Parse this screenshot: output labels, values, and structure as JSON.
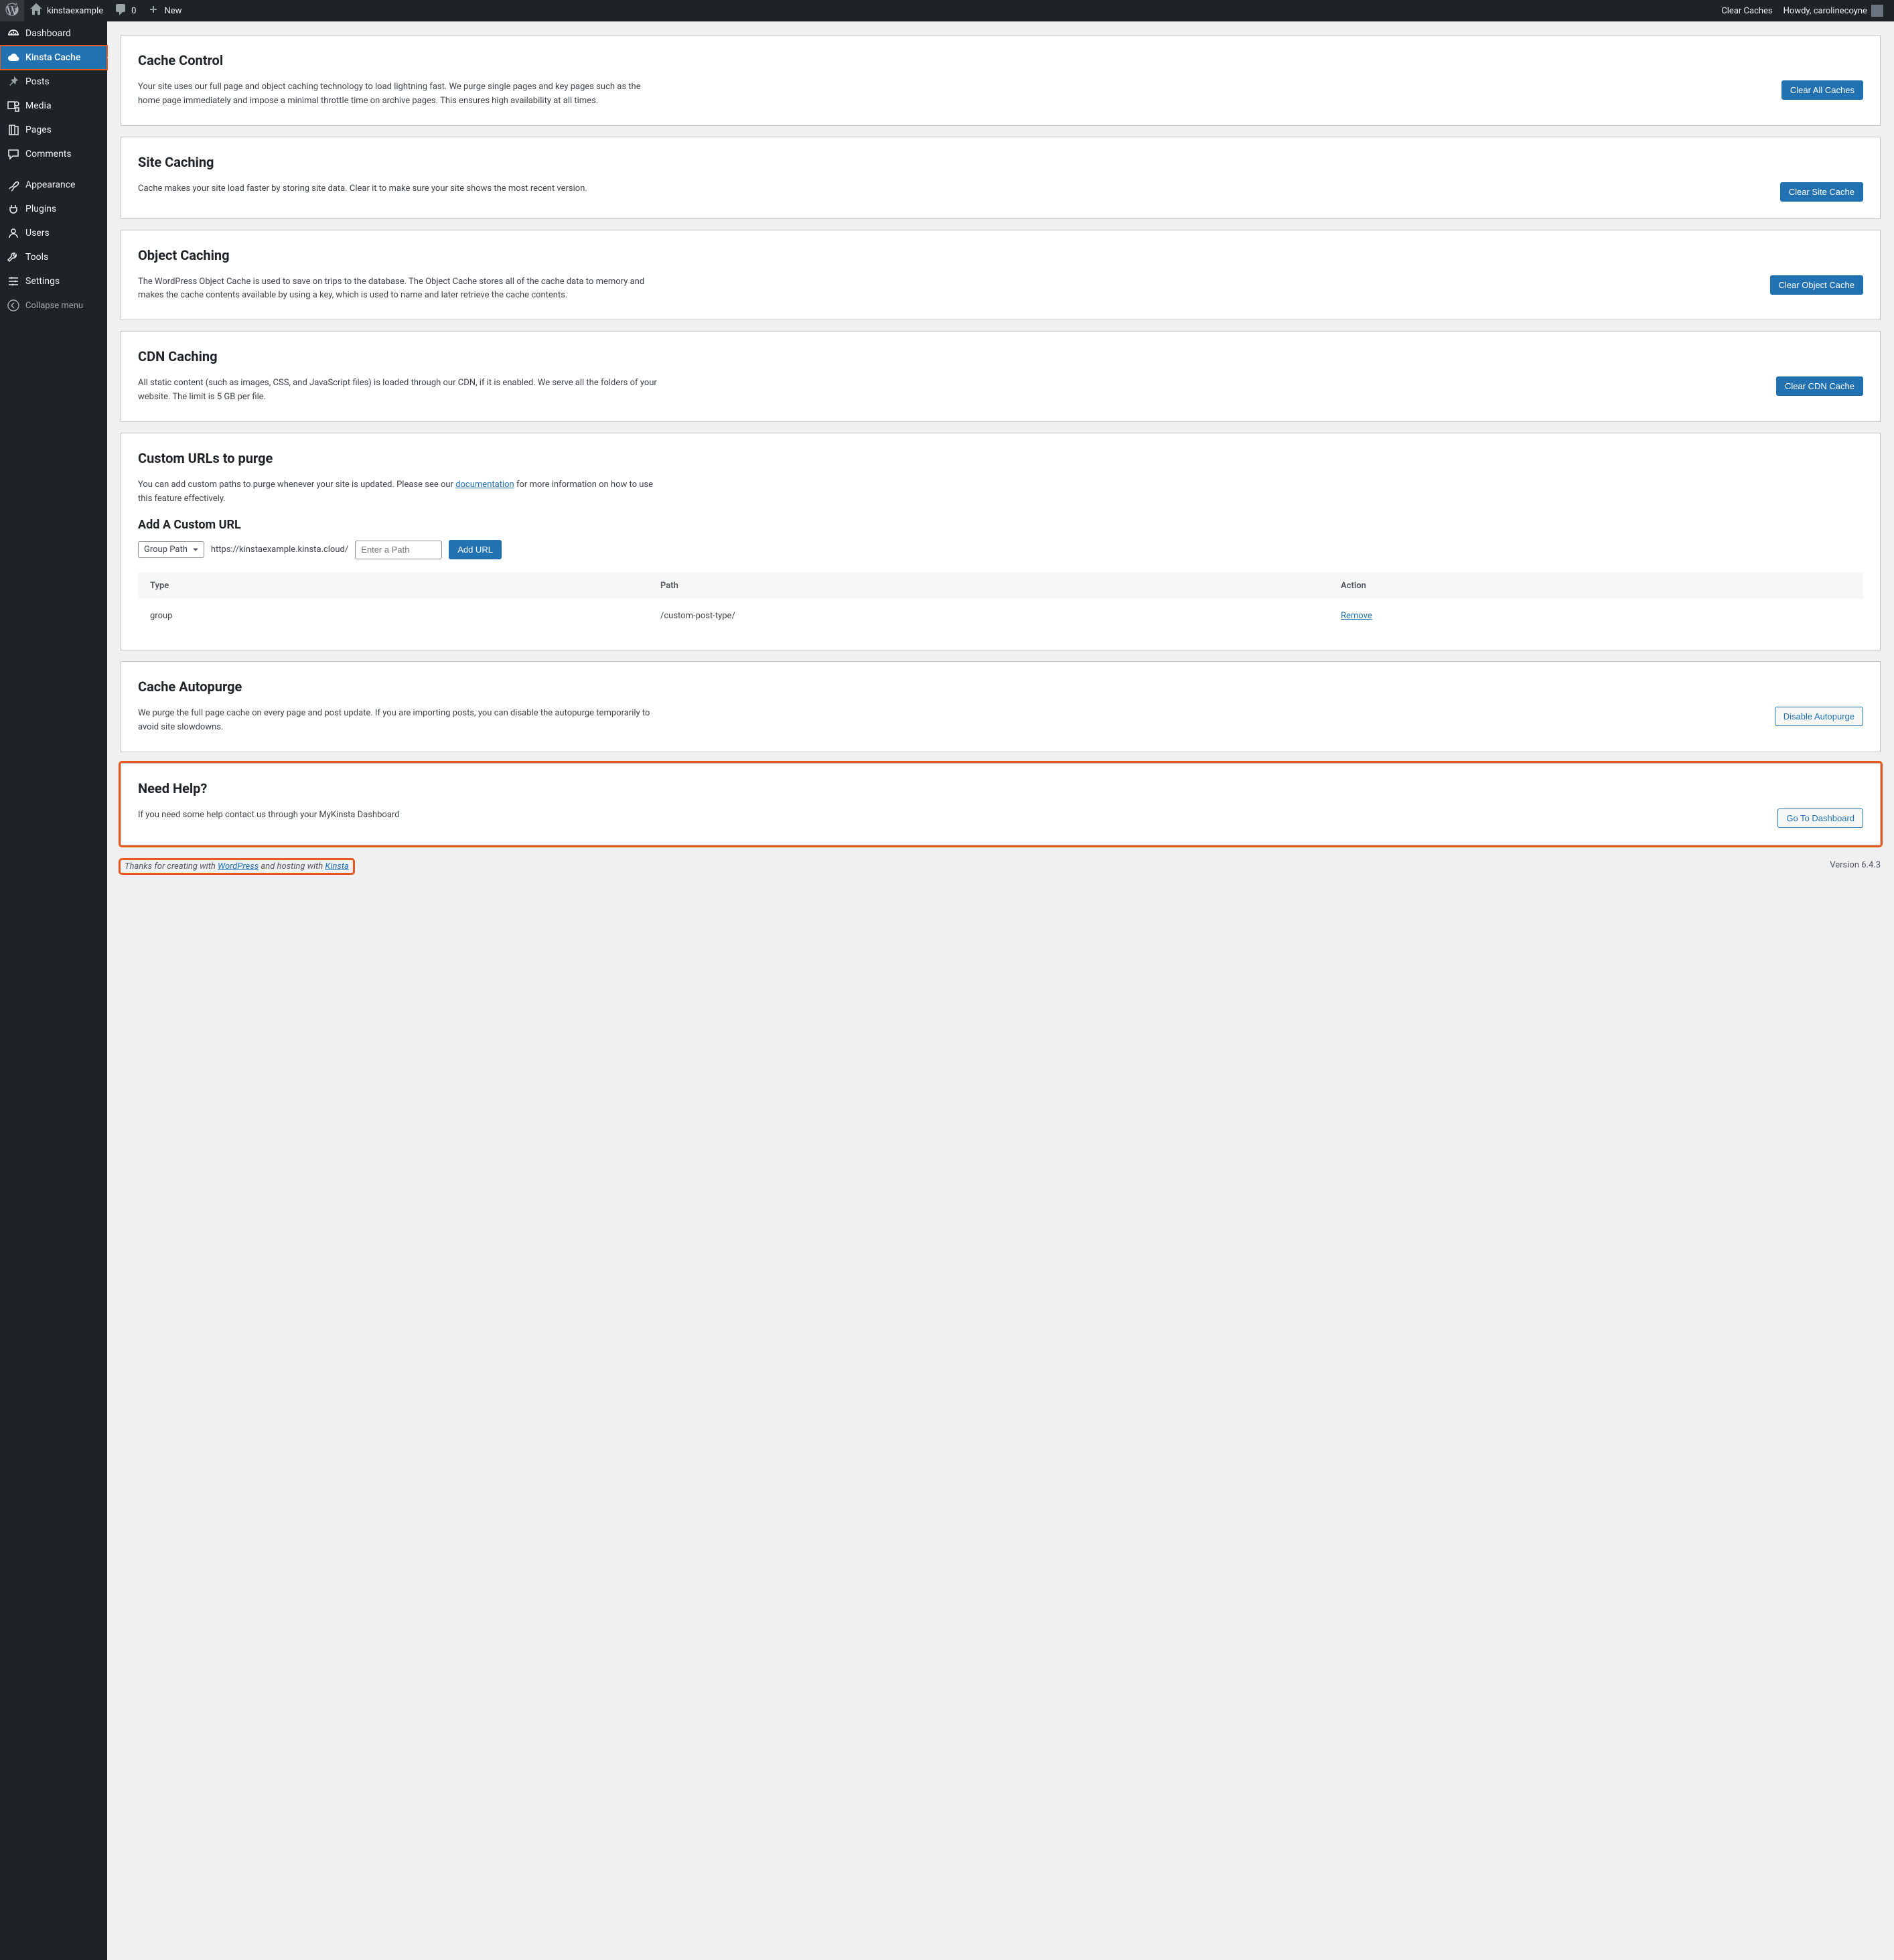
{
  "adminbar": {
    "site_name": "kinstaexample",
    "comments_count": "0",
    "new_label": "New",
    "clear_caches": "Clear Caches",
    "greeting_prefix": "Howdy, ",
    "username": "carolinecoyne"
  },
  "sidebar": {
    "items": [
      {
        "label": "Dashboard",
        "icon": "dashboard"
      },
      {
        "label": "Kinsta Cache",
        "icon": "cloud",
        "current": true
      },
      {
        "label": "Posts",
        "icon": "pin"
      },
      {
        "label": "Media",
        "icon": "media"
      },
      {
        "label": "Pages",
        "icon": "pages"
      },
      {
        "label": "Comments",
        "icon": "comment"
      },
      {
        "label": "Appearance",
        "icon": "brush",
        "sep_before": true
      },
      {
        "label": "Plugins",
        "icon": "plug"
      },
      {
        "label": "Users",
        "icon": "user"
      },
      {
        "label": "Tools",
        "icon": "wrench"
      },
      {
        "label": "Settings",
        "icon": "settings"
      }
    ],
    "collapse": "Collapse menu"
  },
  "sections": {
    "cache_control": {
      "title": "Cache Control",
      "desc": "Your site uses our full page and object caching technology to load lightning fast. We purge single pages and key pages such as the home page immediately and impose a minimal throttle time on archive pages. This ensures high availability at all times.",
      "button": "Clear All Caches"
    },
    "site_caching": {
      "title": "Site Caching",
      "desc": "Cache makes your site load faster by storing site data. Clear it to make sure your site shows the most recent version.",
      "button": "Clear Site Cache"
    },
    "object_caching": {
      "title": "Object Caching",
      "desc": "The WordPress Object Cache is used to save on trips to the database. The Object Cache stores all of the cache data to memory and makes the cache contents available by using a key, which is used to name and later retrieve the cache contents.",
      "button": "Clear Object Cache"
    },
    "cdn_caching": {
      "title": "CDN Caching",
      "desc": "All static content (such as images, CSS, and JavaScript files) is loaded through our CDN, if it is enabled. We serve all the folders of your website. The limit is 5 GB per file.",
      "button": "Clear CDN Cache"
    },
    "custom_urls": {
      "title": "Custom URLs to purge",
      "desc_pre": "You can add custom paths to purge whenever your site is updated. Please see our ",
      "doc_link": "documentation",
      "desc_post": " for more information on how to use this feature effectively.",
      "add_title": "Add A Custom URL",
      "path_type": "Group Path",
      "base_url": "https://kinstaexample.kinsta.cloud/",
      "placeholder": "Enter a Path",
      "add_button": "Add URL",
      "table": {
        "headers": {
          "type": "Type",
          "path": "Path",
          "action": "Action"
        },
        "rows": [
          {
            "type": "group",
            "path": "/custom-post-type/",
            "action": "Remove"
          }
        ]
      }
    },
    "autopurge": {
      "title": "Cache Autopurge",
      "desc": "We purge the full page cache on every page and post update. If you are importing posts, you can disable the autopurge temporarily to avoid site slowdowns.",
      "button": "Disable Autopurge"
    },
    "help": {
      "title": "Need Help?",
      "desc": "If you need some help contact us through your MyKinsta Dashboard",
      "button": "Go To Dashboard"
    }
  },
  "footer": {
    "thanks_pre": "Thanks for creating with ",
    "wp": "WordPress",
    "thanks_mid": " and hosting with ",
    "kinsta": "Kinsta",
    "version": "Version 6.4.3"
  }
}
